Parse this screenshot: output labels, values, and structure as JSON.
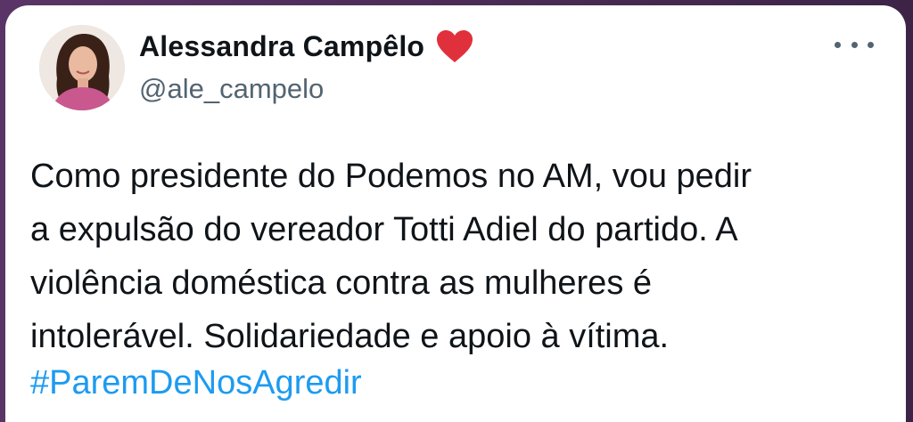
{
  "tweet": {
    "author": {
      "display_name": "Alessandra Campêlo",
      "handle": "@ale_campelo",
      "badge_icon": "red-heart-icon",
      "badge_color": "#e0303c"
    },
    "menu_icon": "more-horizontal-icon",
    "text": "Como presidente do Podemos no AM, vou pedir\na expulsão do vereador Totti Adiel do partido. A\nviolência doméstica contra as mulheres é\nintolerável. Solidariedade e apoio à vítima.",
    "hashtag": "#ParemDeNosAgredir",
    "colors": {
      "text": "#0f1419",
      "secondary": "#536471",
      "link": "#1d9bf0",
      "background_frame": "#4b2b57"
    }
  }
}
